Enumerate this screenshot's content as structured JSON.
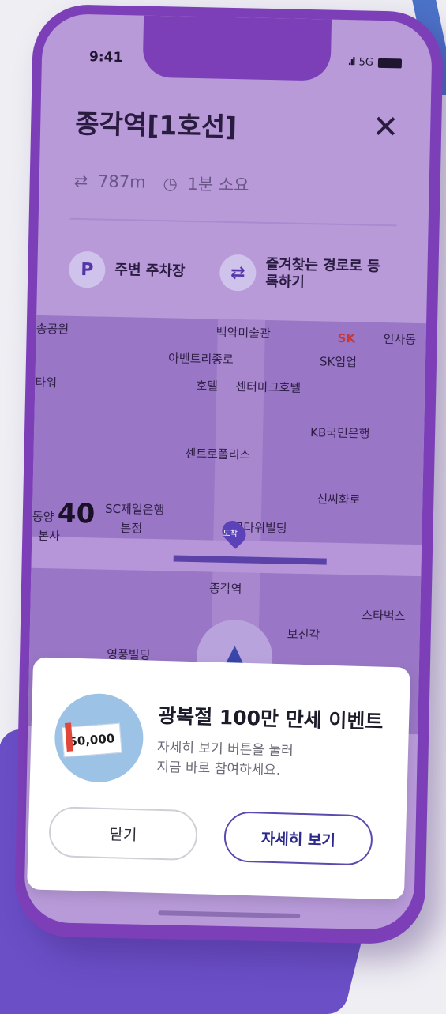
{
  "status_bar": {
    "time": "9:41",
    "network": "5G"
  },
  "header": {
    "title": "종각역[1호선]",
    "close_icon": "close-icon"
  },
  "route_meta": {
    "distance": "787m",
    "duration": "1분 소요"
  },
  "options": {
    "parking": {
      "icon_letter": "P",
      "label": "주변 주차장"
    },
    "favorite": {
      "icon_glyph": "⇄",
      "label": "즐겨찾는 경로로 등록하기"
    }
  },
  "map": {
    "speed_label": "40",
    "pin_label": "도착",
    "pois": [
      "송공원",
      "백악미술관",
      "SK",
      "인사동",
      "아벤트리종로",
      "SK임업",
      "호텔",
      "센터마크호텔",
      "타워",
      "KB국민은행",
      "센트로폴리스",
      "신씨화로",
      "SC제일은행",
      "본점",
      "동양",
      "본사",
      "로타워빌딩",
      "종각역",
      "스타벅스",
      "보신각",
      "영풍빌딩"
    ]
  },
  "event_modal": {
    "title": "광복절 100만 만세 이벤트",
    "desc_line1": "자세히 보기 버튼을 눌러",
    "desc_line2": "지금 바로 참여하세요.",
    "coupon_value": "50,000",
    "close_button": "닫기",
    "detail_button": "자세히 보기"
  },
  "colors": {
    "phone_frame": "#7c3fb8",
    "screen_overlay": "#b89ad9",
    "accent": "#5b4bb0"
  }
}
